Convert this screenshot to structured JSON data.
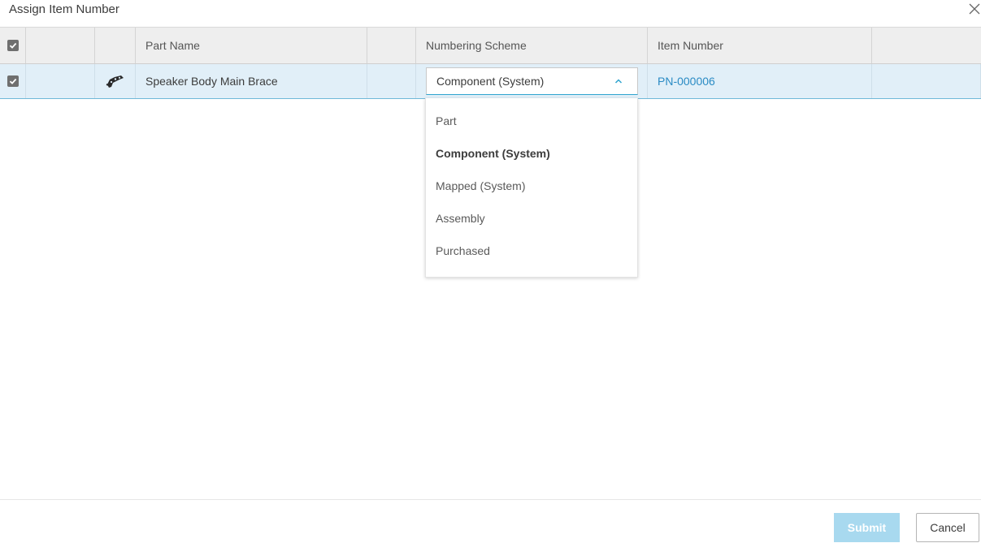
{
  "dialog": {
    "title": "Assign Item Number",
    "close_icon": "close-icon"
  },
  "table": {
    "headers": {
      "part_name": "Part Name",
      "numbering_scheme": "Numbering Scheme",
      "item_number": "Item Number"
    },
    "rows": [
      {
        "checked": true,
        "icon": "part-brace-icon",
        "part_name": "Speaker Body Main Brace",
        "numbering_scheme": "Component (System)",
        "item_number": "PN-000006"
      }
    ]
  },
  "scheme_dropdown": {
    "open": true,
    "selected": "Component (System)",
    "options": [
      "Part",
      "Component (System)",
      "Mapped (System)",
      "Assembly",
      "Purchased"
    ]
  },
  "footer": {
    "submit_label": "Submit",
    "cancel_label": "Cancel"
  },
  "colors": {
    "accent": "#2a8bc4",
    "selected_row": "#e1eff8",
    "submit_disabled": "#a8d9ef"
  }
}
